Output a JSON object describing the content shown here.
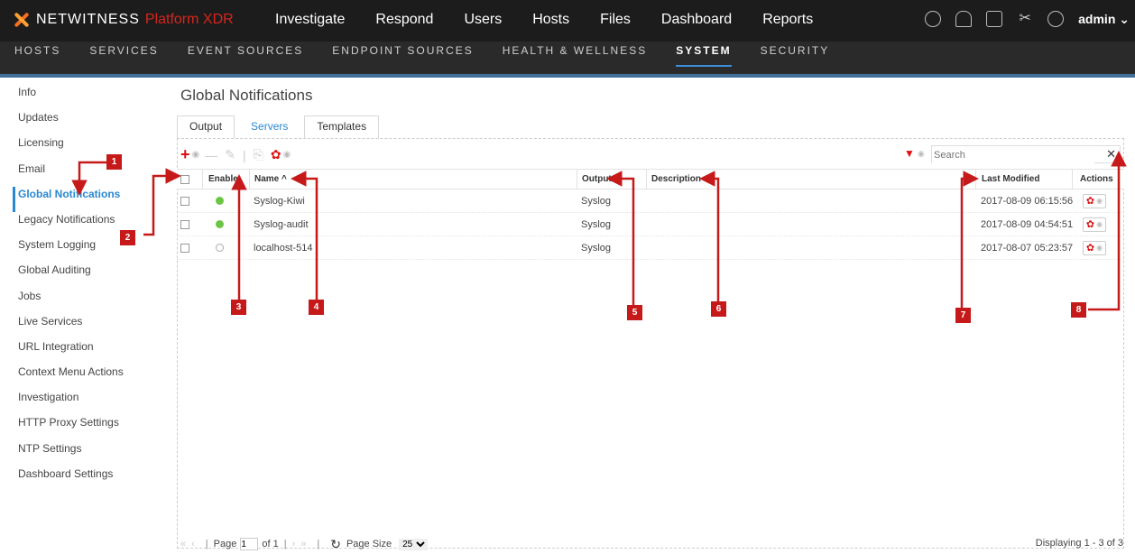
{
  "app": {
    "brand": "NETWITNESS",
    "product": "Platform XDR"
  },
  "main_nav": [
    "Investigate",
    "Respond",
    "Users",
    "Hosts",
    "Files",
    "Dashboard",
    "Reports"
  ],
  "user": {
    "name": "admin"
  },
  "sub_nav": [
    {
      "label": "HOSTS"
    },
    {
      "label": "SERVICES"
    },
    {
      "label": "EVENT SOURCES"
    },
    {
      "label": "ENDPOINT SOURCES"
    },
    {
      "label": "HEALTH & WELLNESS"
    },
    {
      "label": "SYSTEM",
      "active": true
    },
    {
      "label": "SECURITY"
    }
  ],
  "sidebar": [
    "Info",
    "Updates",
    "Licensing",
    "Email",
    "Global Notifications",
    "Legacy Notifications",
    "System Logging",
    "Global Auditing",
    "Jobs",
    "Live Services",
    "URL Integration",
    "Context Menu Actions",
    "Investigation",
    "HTTP Proxy Settings",
    "NTP Settings",
    "Dashboard Settings"
  ],
  "sidebar_active": "Global Notifications",
  "page": {
    "title": "Global Notifications"
  },
  "tabs": [
    {
      "label": "Output"
    },
    {
      "label": "Servers",
      "active": true
    },
    {
      "label": "Templates"
    }
  ],
  "search": {
    "placeholder": "Search"
  },
  "table": {
    "headers": {
      "enable": "Enable",
      "name": "Name ^",
      "output": "Output",
      "description": "Description",
      "last_modified": "Last Modified",
      "actions": "Actions"
    },
    "rows": [
      {
        "enabled": true,
        "name": "Syslog-Kiwi",
        "output": "Syslog",
        "description": "",
        "last_modified": "2017-08-09 06:15:56"
      },
      {
        "enabled": true,
        "name": "Syslog-audit",
        "output": "Syslog",
        "description": "",
        "last_modified": "2017-08-09 04:54:51"
      },
      {
        "enabled": false,
        "name": "localhost-514",
        "output": "Syslog",
        "description": "",
        "last_modified": "2017-08-07 05:23:57"
      }
    ]
  },
  "callouts": [
    "1",
    "2",
    "3",
    "4",
    "5",
    "6",
    "7",
    "8"
  ],
  "pager": {
    "page_label": "Page",
    "page_value": "1",
    "of_label": "of 1",
    "page_size_label": "Page Size",
    "page_size": "25",
    "displaying": "Displaying 1 - 3 of 3"
  },
  "colors": {
    "accent": "#2a88d0",
    "callout": "#c61a1a",
    "enabled": "#6cc644"
  }
}
